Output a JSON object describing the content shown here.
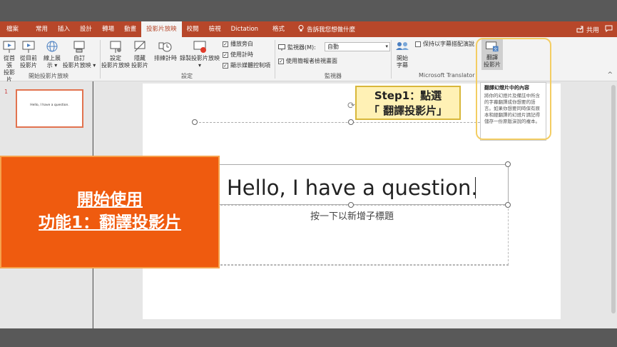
{
  "tabs": [
    {
      "label": "檔案"
    },
    {
      "label": "常用"
    },
    {
      "label": "插入"
    },
    {
      "label": "設計"
    },
    {
      "label": "轉場"
    },
    {
      "label": "動畫"
    },
    {
      "label": "投影片放映",
      "active": true
    },
    {
      "label": "校閱"
    },
    {
      "label": "檢視"
    },
    {
      "label": "Dictation"
    },
    {
      "label": "格式"
    }
  ],
  "tell_me": "告訴我您想做什麼",
  "share": "共用",
  "ribbon": {
    "start": {
      "from_beginning": [
        "從首張",
        "投影片"
      ],
      "from_current": [
        "從目前",
        "投影片"
      ],
      "online": [
        "線上展",
        "示 ▾"
      ],
      "custom": [
        "自訂",
        "投影片放映 ▾"
      ],
      "group": "開始投影片放映"
    },
    "setup": {
      "setup_show": [
        "設定",
        "投影片放映"
      ],
      "hide_slide": [
        "隱藏",
        "投影片"
      ],
      "rehearse": [
        "排練計時"
      ],
      "record": [
        "錄製投影片放映",
        "▾"
      ],
      "play_narrations": "播放旁白",
      "use_timings": "使用計時",
      "show_media_controls": "顯示媒體控制項",
      "group": "設定"
    },
    "monitors": {
      "monitor_label": "監視器(M):",
      "monitor_value": "自動",
      "presenter_view": "使用簡報者檢視畫面",
      "group": "監視器"
    },
    "subtitles": {
      "start_subtitles": [
        "開始",
        "字幕"
      ],
      "keep_sync": "保持以字幕搭配演說"
    },
    "translator": {
      "translate": [
        "翻譯",
        "投影片"
      ],
      "group": "Microsoft Translator"
    }
  },
  "tooltip": {
    "title": "翻譯幻燈片中的內容",
    "body": "將你的幻燈片及備註中所含的字幕翻譯成你想要的語言。如果你想要同時保有原本和經翻譯的幻燈片請記得儲存一份原版演說的複本。"
  },
  "thumbnail": {
    "number": "1",
    "text": "Hello, I have a question."
  },
  "slide": {
    "title": "Hello, I have a question.",
    "subtitle": "按一下以新增子標題"
  },
  "callouts": {
    "step1_line1": "Step1：點選",
    "step1_line2": "「 翻譯投影片」",
    "heading_line1": "開始使用",
    "heading_line2": "功能1：翻譯投影片"
  },
  "colors": {
    "tab_accent": "#b7472a",
    "callout_orange": "#ef5b0f",
    "highlight_yellow": "#f3cd63"
  }
}
